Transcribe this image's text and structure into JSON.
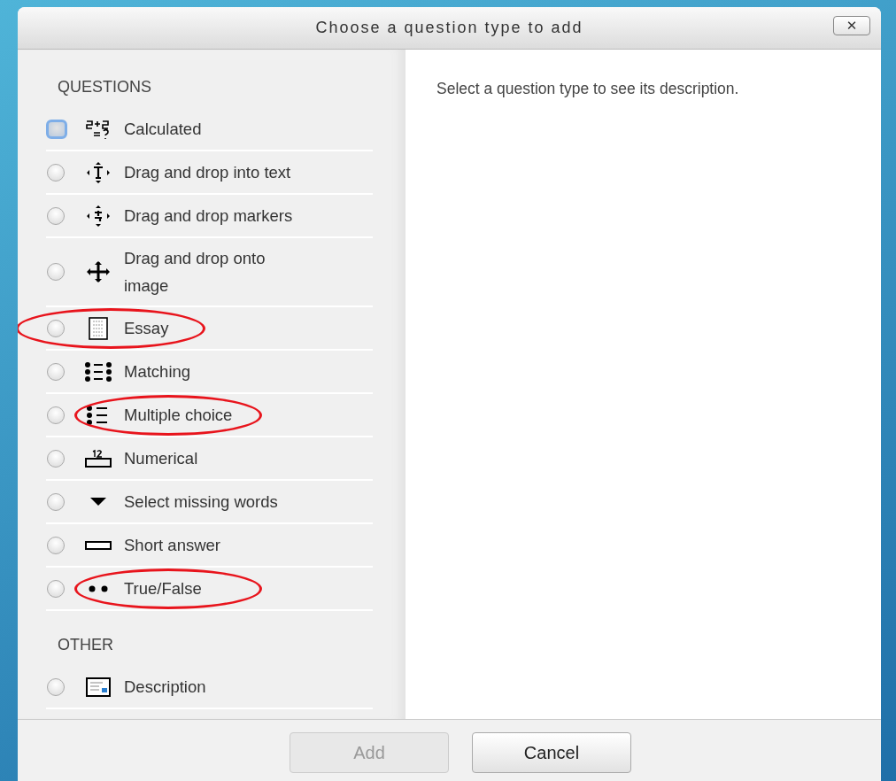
{
  "dialog": {
    "title": "Choose a question type to add",
    "close_label": "✕"
  },
  "sections": [
    {
      "heading": "QUESTIONS",
      "items": [
        {
          "label": "Calculated",
          "selected": false,
          "focused": true,
          "circled": false
        },
        {
          "label": "Drag and drop into text",
          "selected": false,
          "focused": false,
          "circled": false
        },
        {
          "label": "Drag and drop markers",
          "selected": false,
          "focused": false,
          "circled": false
        },
        {
          "label": "Drag and drop onto image",
          "selected": false,
          "focused": false,
          "circled": false
        },
        {
          "label": "Essay",
          "selected": false,
          "focused": false,
          "circled": true
        },
        {
          "label": "Matching",
          "selected": false,
          "focused": false,
          "circled": false
        },
        {
          "label": "Multiple choice",
          "selected": false,
          "focused": false,
          "circled": true
        },
        {
          "label": "Numerical",
          "selected": false,
          "focused": false,
          "circled": false
        },
        {
          "label": "Select missing words",
          "selected": false,
          "focused": false,
          "circled": false
        },
        {
          "label": "Short answer",
          "selected": false,
          "focused": false,
          "circled": false
        },
        {
          "label": "True/False",
          "selected": false,
          "focused": false,
          "circled": true
        }
      ]
    },
    {
      "heading": "OTHER",
      "items": [
        {
          "label": "Description",
          "selected": false,
          "focused": false,
          "circled": false
        }
      ]
    }
  ],
  "description": "Select a question type to see its description.",
  "buttons": [
    {
      "label": "Add",
      "disabled": true
    },
    {
      "label": "Cancel",
      "disabled": false
    }
  ]
}
